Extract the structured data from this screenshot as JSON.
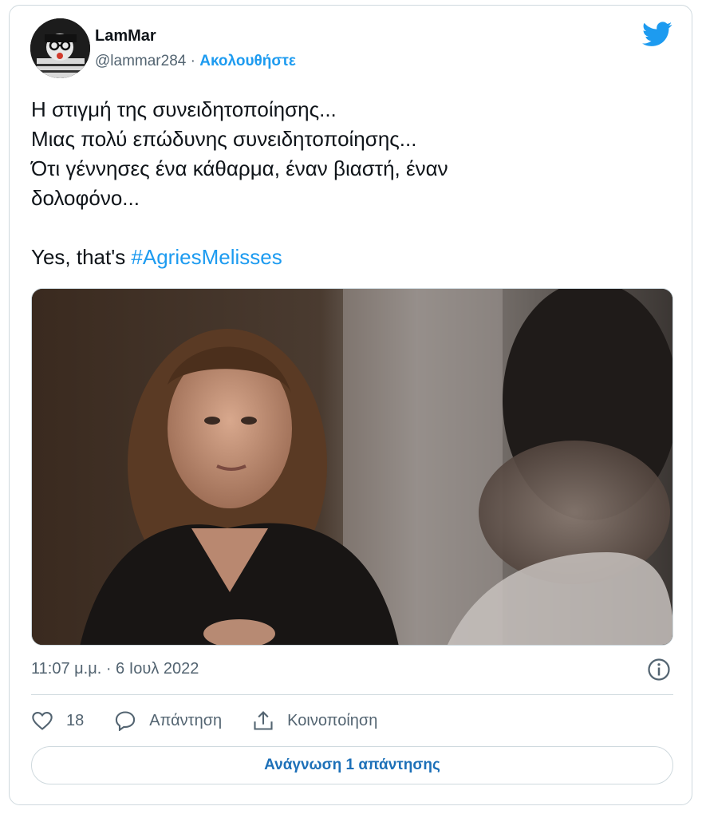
{
  "author": {
    "name": "LamMar",
    "handle": "@lammar284",
    "separator": " · ",
    "follow_label": "Ακολουθήστε"
  },
  "tweet": {
    "lines": [
      "Η στιγμή της συνειδητοποίησης...",
      "Μιας πολύ επώδυνης συνειδητοποίησης...",
      "Ότι γέννησες ένα κάθαρμα, έναν βιαστή, έναν",
      "δολοφόνο..."
    ],
    "closing_prefix": "Yes, that's ",
    "hashtag": "#AgriesMelisses"
  },
  "meta": {
    "timestamp": "11:07 μ.μ. · 6 Ιουλ 2022"
  },
  "actions": {
    "like_count": "18",
    "reply_label": "Απάντηση",
    "share_label": "Κοινοποίηση"
  },
  "read_replies_label": "Ανάγνωση 1 απάντησης",
  "colors": {
    "accent": "#1d9bf0",
    "text": "#0f1419",
    "secondary": "#536471",
    "border": "#cfd9de"
  },
  "icons": [
    "twitter-bird-icon",
    "info-icon",
    "heart-icon",
    "reply-bubble-icon",
    "share-icon"
  ]
}
